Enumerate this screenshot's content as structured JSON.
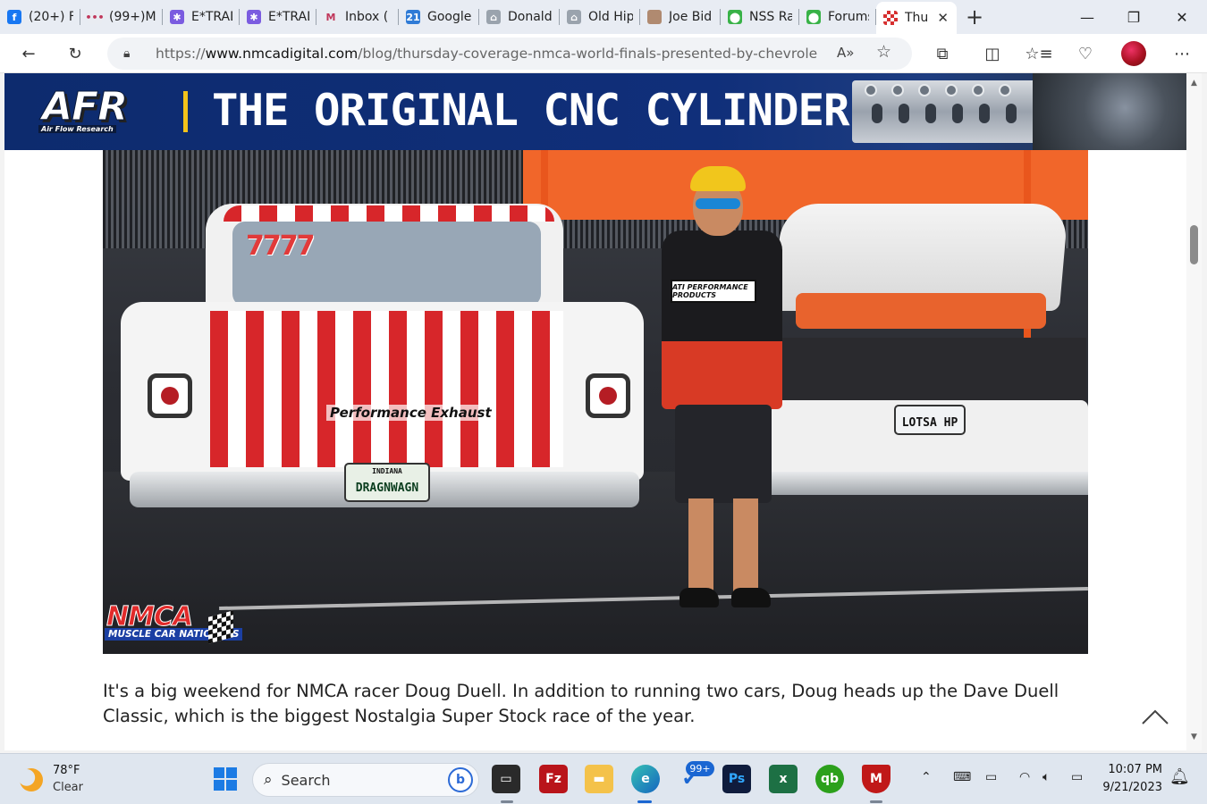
{
  "browser": {
    "tabs": [
      {
        "label": "(20+) F",
        "icon": "facebook-icon",
        "color": "#1877f2",
        "glyph": "f"
      },
      {
        "label": "(99+)M",
        "icon": "dots-icon",
        "color": "#e9ecf2",
        "glyph": "•••"
      },
      {
        "label": "E*TRAD",
        "icon": "etrade-icon",
        "color": "#7b5ce0",
        "glyph": "✱"
      },
      {
        "label": "E*TRAD",
        "icon": "etrade-icon",
        "color": "#7b5ce0",
        "glyph": "✱"
      },
      {
        "label": "Inbox (",
        "icon": "gmail-icon",
        "color": "#e9ecf2",
        "glyph": "M"
      },
      {
        "label": "Google",
        "icon": "calendar-icon",
        "color": "#2f7bd6",
        "glyph": "21"
      },
      {
        "label": "Donald",
        "icon": "person-icon",
        "color": "#9aa3ad",
        "glyph": "⌂"
      },
      {
        "label": "Old Hip",
        "icon": "person-icon",
        "color": "#9aa3ad",
        "glyph": "⌂"
      },
      {
        "label": "Joe Bid",
        "icon": "photo-icon",
        "color": "#b08a70",
        "glyph": ""
      },
      {
        "label": "NSS Ra",
        "icon": "forum-icon",
        "color": "#38b247",
        "glyph": "⬤"
      },
      {
        "label": "Forums",
        "icon": "forum-icon",
        "color": "#38b247",
        "glyph": "⬤"
      }
    ],
    "active_tab": {
      "label": "Thu",
      "icon": "checkered-flag-icon",
      "color": "#d62f2f"
    },
    "url_prefix": "https://",
    "url_domain": "www.nmcadigital.com",
    "url_path": "/blog/thursday-coverage-nmca-world-finals-presented-by-chevrolet-pe..."
  },
  "ad": {
    "logo_main": "AFR",
    "logo_sub": "Air Flow Research",
    "headline": "THE ORIGINAL CNC CYLINDER HEAD",
    "accent": "#f2c21b",
    "bg": "#0d2b6e"
  },
  "photo": {
    "car_plate_state": "INDIANA",
    "car_plate": "DRAGNWAGN",
    "car_number": "7777",
    "brand_text": "Performance Exhaust",
    "shirt_logo": "ATI PERFORMANCE PRODUCTS",
    "second_plate": "LOTSA HP",
    "watermark_main": "NMCA",
    "watermark_sub": "MUSCLE CAR NATIONALS"
  },
  "article": {
    "paragraph": "It's a big weekend for NMCA racer Doug Duell. In addition to running two cars, Doug heads up the Dave Duell Classic, which is the biggest Nostalgia Super Stock race of the year."
  },
  "taskbar": {
    "weather_temp": "78°F",
    "weather_cond": "Clear",
    "search_placeholder": "Search",
    "mail_badge": "99+",
    "time": "10:07 PM",
    "date": "9/21/2023"
  }
}
